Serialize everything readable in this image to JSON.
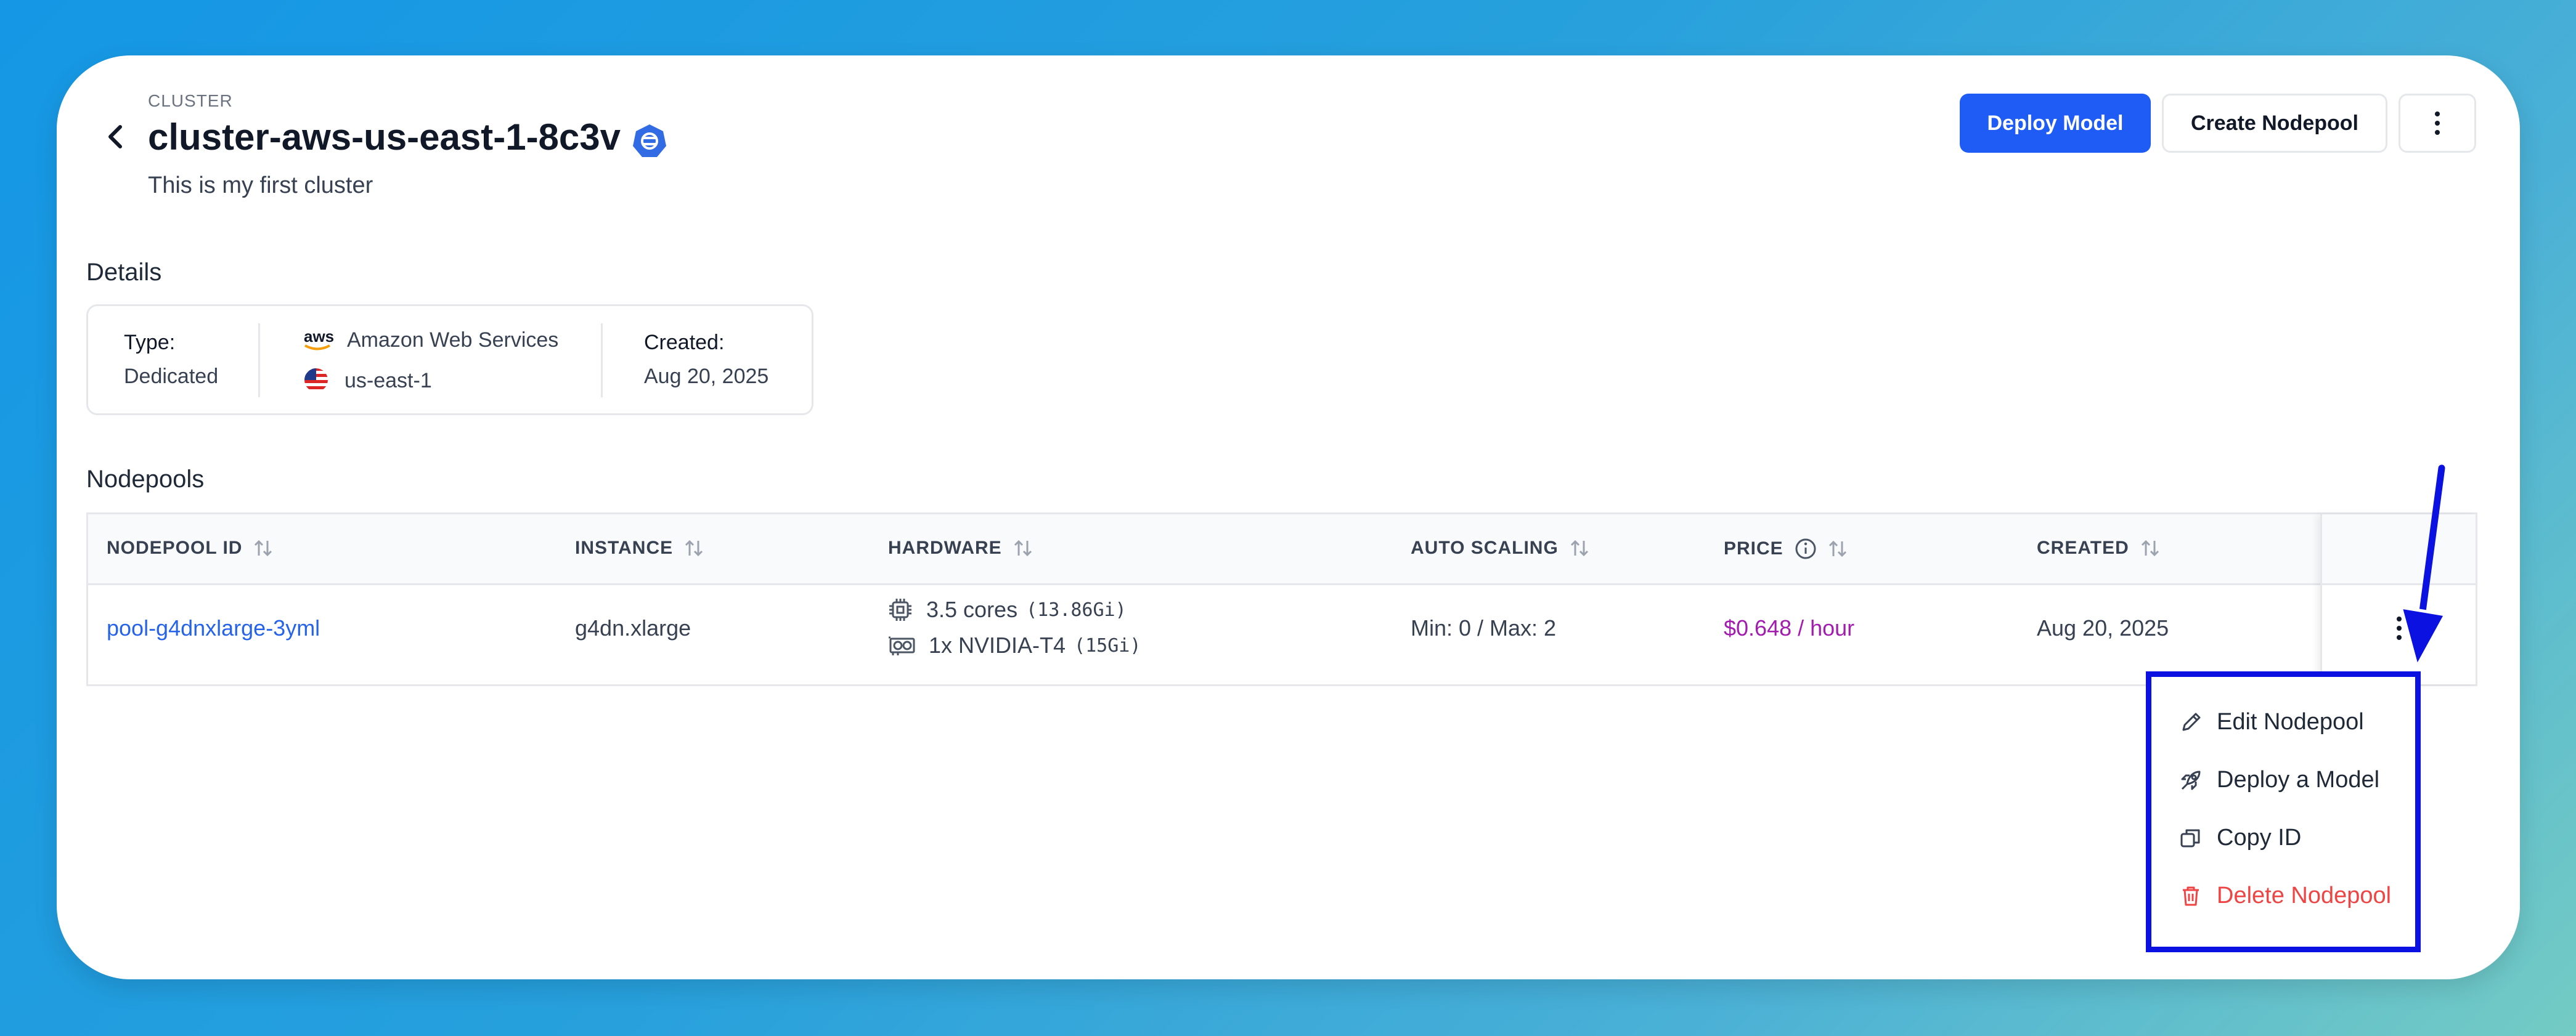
{
  "header": {
    "cluster_label": "CLUSTER",
    "title": "cluster-aws-us-east-1-8c3v",
    "description": "This is my first cluster"
  },
  "actions": {
    "deploy_model": "Deploy Model",
    "create_nodepool": "Create Nodepool"
  },
  "details": {
    "section_title": "Details",
    "type_label": "Type:",
    "type_value": "Dedicated",
    "provider_logo_text": "aws",
    "provider": "Amazon Web Services",
    "region": "us-east-1",
    "created_label": "Created:",
    "created_value": "Aug 20, 2025"
  },
  "nodepools": {
    "section_title": "Nodepools",
    "columns": [
      "NODEPOOL ID",
      "INSTANCE",
      "HARDWARE",
      "AUTO SCALING",
      "PRICE",
      "CREATED"
    ],
    "rows": [
      {
        "id": "pool-g4dnxlarge-3yml",
        "instance": "g4dn.xlarge",
        "cpu": "3.5 cores",
        "cpu_mem": "(13.86Gi)",
        "gpu": "1x NVIDIA-T4",
        "gpu_mem": "(15Gi)",
        "auto_scaling": "Min: 0 / Max: 2",
        "price": "$0.648 / hour",
        "created": "Aug 20, 2025"
      }
    ]
  },
  "row_menu": {
    "items": [
      {
        "label": "Edit Nodepool",
        "icon": "pencil-icon"
      },
      {
        "label": "Deploy a Model",
        "icon": "rocket-icon"
      },
      {
        "label": "Copy ID",
        "icon": "copy-icon"
      },
      {
        "label": "Delete Nodepool",
        "icon": "trash-icon"
      }
    ]
  },
  "colors": {
    "primary": "#1f5cf6",
    "link": "#2563eb",
    "price": "#a21caf",
    "danger": "#ef4444",
    "highlight": "#0a11e0"
  }
}
